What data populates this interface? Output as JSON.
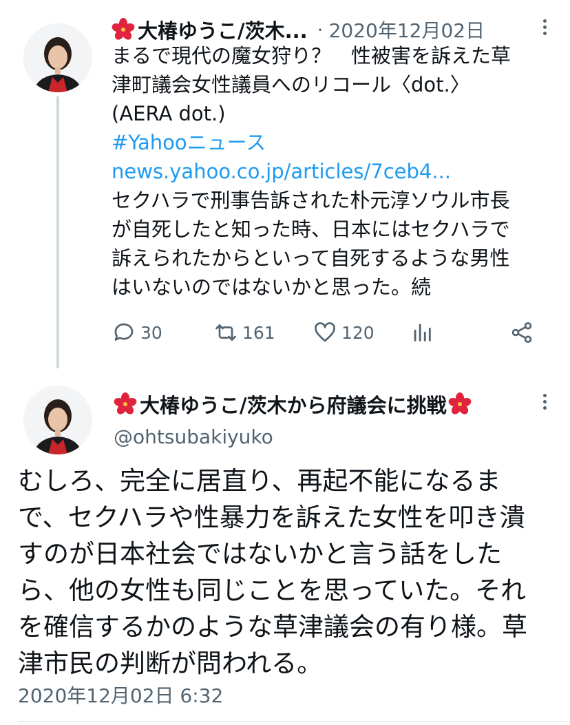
{
  "tweet1": {
    "author": "大椿ゆうこ/茨木...",
    "separator": "·",
    "date": "2020年12月02日",
    "text_lines": [
      "まるで現代の魔女狩り？　性被害を訴えた草",
      "津町議会女性議員へのリコール〈dot.〉",
      "(AERA dot.)"
    ],
    "hashtag": "#Yahooニュース",
    "link": "news.yahoo.co.jp/articles/7ceb4...",
    "body_lines": [
      "セクハラで刑事告訴された朴元淳ソウル市長",
      "が自死したと知った時、日本にはセクハラで",
      "訴えられたからといって自死するような男性",
      "はいないのではないかと思った。続"
    ],
    "actions": {
      "reply_count": "30",
      "retweet_count": "161",
      "like_count": "120"
    }
  },
  "tweet2": {
    "author": "大椿ゆうこ/茨木から府議会に挑戦",
    "handle": "@ohtsubakiyuko",
    "text_lines": [
      "むしろ、完全に居直り、再起不能になるま",
      "で、セクハラや性暴力を訴えた女性を叩き潰",
      "すのが日本社会ではないかと言う話をした",
      "ら、他の女性も同じことを思っていた。それ",
      "を確信するかのような草津議会の有り様。草",
      "津市民の判断が問われる。"
    ],
    "timestamp": "2020年12月02日 6:32"
  },
  "colors": {
    "text": "#0f1419",
    "secondary": "#536471",
    "link": "#1d9bf0",
    "hibiscus": "#e0243d",
    "avatar_top": "#c9262c"
  },
  "icons": [
    "hibiscus-emoji",
    "more-icon",
    "reply-icon",
    "retweet-icon",
    "like-icon",
    "views-icon",
    "share-icon"
  ]
}
